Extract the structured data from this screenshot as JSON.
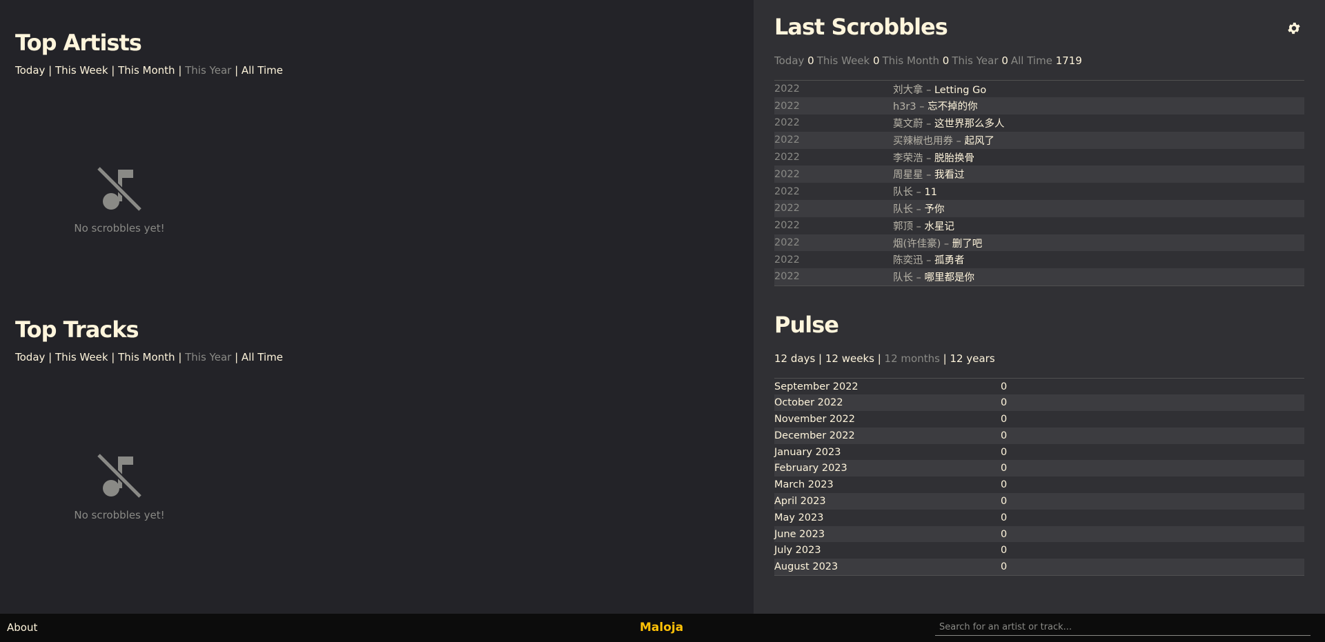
{
  "top_artists": {
    "title": "Top Artists",
    "ranges": [
      "Today",
      "This Week",
      "This Month",
      "This Year",
      "All Time"
    ],
    "active_range": "This Year",
    "empty_text": "No scrobbles yet!"
  },
  "top_tracks": {
    "title": "Top Tracks",
    "ranges": [
      "Today",
      "This Week",
      "This Month",
      "This Year",
      "All Time"
    ],
    "active_range": "This Year",
    "empty_text": "No scrobbles yet!"
  },
  "last_scrobbles": {
    "title": "Last Scrobbles",
    "counts": [
      {
        "label": "Today",
        "value": "0"
      },
      {
        "label": "This Week",
        "value": "0"
      },
      {
        "label": "This Month",
        "value": "0"
      },
      {
        "label": "This Year",
        "value": "0"
      },
      {
        "label": "All Time",
        "value": "1719"
      }
    ],
    "rows": [
      {
        "time": "2022",
        "artist": "刘大拿",
        "title": "Letting Go"
      },
      {
        "time": "2022",
        "artist": "h3r3",
        "title": "忘不掉的你"
      },
      {
        "time": "2022",
        "artist": "莫文蔚",
        "title": "这世界那么多人"
      },
      {
        "time": "2022",
        "artist": "买辣椒也用券",
        "title": "起风了"
      },
      {
        "time": "2022",
        "artist": "李荣浩",
        "title": "脱胎换骨"
      },
      {
        "time": "2022",
        "artist": "周星星",
        "title": "我看过"
      },
      {
        "time": "2022",
        "artist": "队长",
        "title": "11"
      },
      {
        "time": "2022",
        "artist": "队长",
        "title": "予你"
      },
      {
        "time": "2022",
        "artist": "郭顶",
        "title": "水星记"
      },
      {
        "time": "2022",
        "artist": "烟(许佳豪)",
        "title": "删了吧"
      },
      {
        "time": "2022",
        "artist": "陈奕迅",
        "title": "孤勇者"
      },
      {
        "time": "2022",
        "artist": "队长",
        "title": "哪里都是你"
      }
    ]
  },
  "pulse": {
    "title": "Pulse",
    "ranges": [
      "12 days",
      "12 weeks",
      "12 months",
      "12 years"
    ],
    "active_range": "12 months",
    "rows": [
      {
        "period": "September 2022",
        "count": "0"
      },
      {
        "period": "October 2022",
        "count": "0"
      },
      {
        "period": "November 2022",
        "count": "0"
      },
      {
        "period": "December 2022",
        "count": "0"
      },
      {
        "period": "January 2023",
        "count": "0"
      },
      {
        "period": "February 2023",
        "count": "0"
      },
      {
        "period": "March 2023",
        "count": "0"
      },
      {
        "period": "April 2023",
        "count": "0"
      },
      {
        "period": "May 2023",
        "count": "0"
      },
      {
        "period": "June 2023",
        "count": "0"
      },
      {
        "period": "July 2023",
        "count": "0"
      },
      {
        "period": "August 2023",
        "count": "0"
      }
    ]
  },
  "footer": {
    "about": "About",
    "brand": "Maloja",
    "search_placeholder": "Search for an artist or track..."
  },
  "icons": {
    "settings": "gear-icon",
    "no_music": "music-off-icon"
  },
  "colors": {
    "background": "#232328",
    "panel": "#303034",
    "text": "#fff5dc",
    "muted": "#8a8a86",
    "accent": "#ffc107"
  }
}
